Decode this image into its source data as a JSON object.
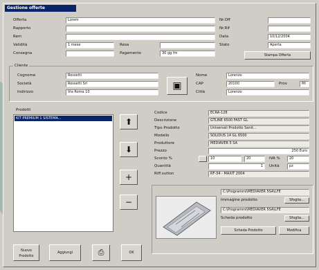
{
  "window": {
    "title": "Gestione offerte"
  },
  "header": {
    "left_labels": [
      "Offerta",
      "Rapporto",
      "Rem",
      "Validità",
      "Consegna"
    ],
    "values": {
      "offerta": "Lorem",
      "validita": "1 mese",
      "pagamento": "30 gg fm"
    },
    "mid_labels": {
      "resa": "Resa",
      "pagamento": "Pagamento"
    },
    "right_labels": [
      "Nr.Off",
      "Nr.Rif",
      "Data",
      "Stato"
    ],
    "right_values": {
      "data": "10/12/2004",
      "stato": "Aperta"
    },
    "stampa_button": "Stampa Offerta"
  },
  "cliente": {
    "legend": "Cliente",
    "labels": [
      "Cognome",
      "Società",
      "Indirizzo"
    ],
    "values": [
      "Rossetti",
      "Rossetti Srl",
      "Via Roma 10"
    ],
    "right_labels": [
      "Nome",
      "CAP",
      "Città"
    ],
    "right_values": {
      "nome": "Lorenzo",
      "cap": "20100",
      "prov": "MI",
      "citta": "Lorenzo"
    },
    "prov_label": "Prov"
  },
  "prodotti": {
    "legend": "Prodotti",
    "selected": "KIT PREMIUM 1 SISTEMA..."
  },
  "side_buttons": {
    "up": "⬆",
    "down": "⬇",
    "add": "+",
    "remove": "−"
  },
  "details": {
    "labels": [
      "Codice",
      "Descrizione",
      "Tipo Prodotto",
      "Modello",
      "Produttore",
      "Prezzo",
      "Sconto %",
      "Quantità",
      "Riff.sutton"
    ],
    "values": {
      "codice": "ECRA-128",
      "descrizione": "GTLINE 6500 FAST GL",
      "tipo": "Universali Prodotto Sanit...",
      "modello": "SOLIDUS 14 GL 6500",
      "produttore": "MEDIAVER 5 SA",
      "prezzo": "250 Euro",
      "sconto_a": "10",
      "sconto_b": "20",
      "iva_label": "IVA %",
      "iva": "20",
      "quantita": "1",
      "unita_label": "Unità",
      "unita": "pz",
      "riff": "RF-34 - MAXIT 2004"
    }
  },
  "files": {
    "path1": "C:\\Programmi\\MEDIAVER 5SA\\LFE",
    "img_label": "Immagine prodotto",
    "path2": "C:\\Programmi\\MEDIAVER 5SA\\LFE",
    "scheda_label": "Scheda prodotto",
    "sfoglia": "Sfoglia...",
    "btn_scheda": "Scheda Prodotto",
    "btn_modifica": "Modifica"
  },
  "bottom_buttons": {
    "new": "Nuovo Prodotto",
    "add": "Aggiungi",
    "print": "⎙",
    "ok": "OK"
  }
}
